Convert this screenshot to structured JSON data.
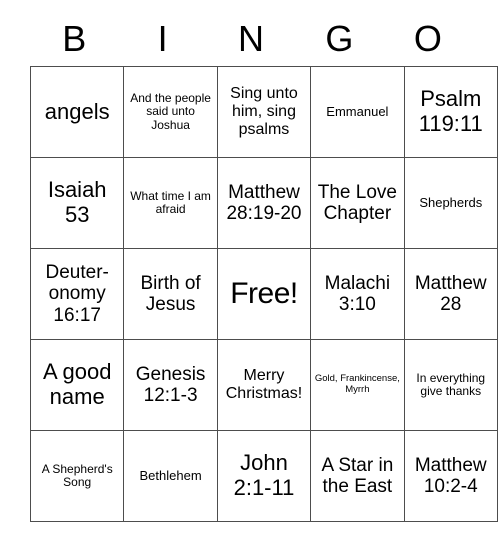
{
  "card": {
    "header_letters": [
      "B",
      "I",
      "N",
      "G",
      "O"
    ],
    "free_space_label": "Free!",
    "colors": {
      "background": "#ffffff",
      "border": "#4d4d4d",
      "text": "#000000"
    },
    "rows": [
      [
        {
          "text": "angels",
          "size": "lg"
        },
        {
          "text": "And the people said unto Joshua",
          "size": "xxs"
        },
        {
          "text": "Sing unto him, sing psalms",
          "size": "sm"
        },
        {
          "text": "Emmanuel",
          "size": "xs"
        },
        {
          "text": "Psalm 119:11",
          "size": "lg"
        }
      ],
      [
        {
          "text": "Isaiah 53",
          "size": "lg"
        },
        {
          "text": "What time I am afraid",
          "size": "xxs"
        },
        {
          "text": "Matthew 28:19-20",
          "size": "md"
        },
        {
          "text": "The Love Chapter",
          "size": "md"
        },
        {
          "text": "Shepherds",
          "size": "xs"
        }
      ],
      [
        {
          "text": "Deuter-onomy 16:17",
          "size": "md"
        },
        {
          "text": "Birth of Jesus",
          "size": "md"
        },
        {
          "text": "Free!",
          "size": "xl"
        },
        {
          "text": "Malachi 3:10",
          "size": "md"
        },
        {
          "text": "Matthew 28",
          "size": "md"
        }
      ],
      [
        {
          "text": "A good name",
          "size": "lg"
        },
        {
          "text": "Genesis 12:1-3",
          "size": "md"
        },
        {
          "text": "Merry Christmas!",
          "size": "sm"
        },
        {
          "text": "Gold, Frankincense, Myrrh",
          "size": "tiny"
        },
        {
          "text": "In everything give thanks",
          "size": "xxs"
        }
      ],
      [
        {
          "text": "A Shepherd's Song",
          "size": "xxs"
        },
        {
          "text": "Bethlehem",
          "size": "xs"
        },
        {
          "text": "John 2:1-11",
          "size": "lg"
        },
        {
          "text": "A Star in the East",
          "size": "md"
        },
        {
          "text": "Matthew 10:2-4",
          "size": "md"
        }
      ]
    ]
  }
}
